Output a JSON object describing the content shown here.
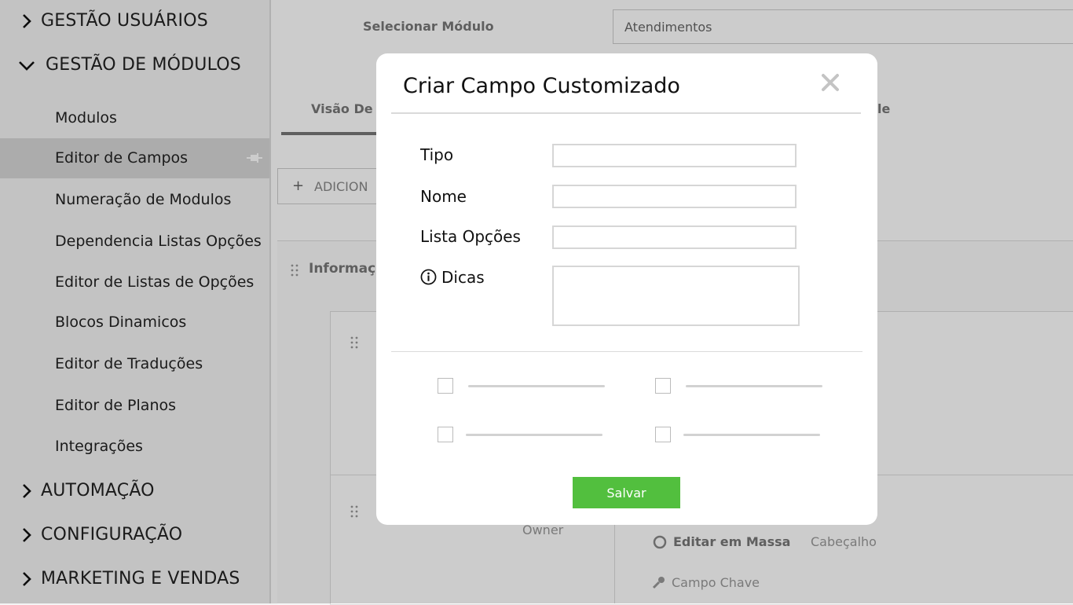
{
  "sidebar": {
    "sections_top": [
      {
        "label": "GESTÃO USUÁRIOS",
        "state": "collapsed"
      },
      {
        "label": "GESTÃO DE MÓDULOS",
        "state": "expanded"
      }
    ],
    "items": [
      {
        "label": "Modulos"
      },
      {
        "label": "Editor de Campos",
        "active": true
      },
      {
        "label": "Numeração de Modulos"
      },
      {
        "label": "Dependencia Listas Opções"
      },
      {
        "label": "Editor de Listas de Opções"
      },
      {
        "label": "Blocos Dinamicos"
      },
      {
        "label": "Editor de Traduções"
      },
      {
        "label": "Editor de Planos"
      },
      {
        "label": "Integrações"
      }
    ],
    "sections_bottom": [
      {
        "label": "AUTOMAÇÃO"
      },
      {
        "label": "CONFIGURAÇÃO"
      },
      {
        "label": "MARKETING E VENDAS"
      }
    ]
  },
  "background": {
    "select_module_label": "Selecionar Módulo",
    "select_module_value": "Atendimentos",
    "tab_partial": "Visão De",
    "tab_partial_right": "le",
    "add_button_partial": "ADICION",
    "panel_header_partial": "Informaç",
    "owner_label": "Owner",
    "mass_edit_label": "Editar em Massa",
    "header_label": "Cabeçalho",
    "key_field_label": "Campo Chave"
  },
  "modal": {
    "title": "Criar Campo Customizado",
    "fields": {
      "tipo_label": "Tipo",
      "nome_label": "Nome",
      "lista_label": "Lista Opções",
      "dicas_label": "Dicas"
    },
    "save_label": "Salvar"
  },
  "colors": {
    "save_button": "#52bf3e",
    "active_sidebar": "#d7d7d7",
    "overlay": "rgba(0,0,0,0.2)"
  }
}
